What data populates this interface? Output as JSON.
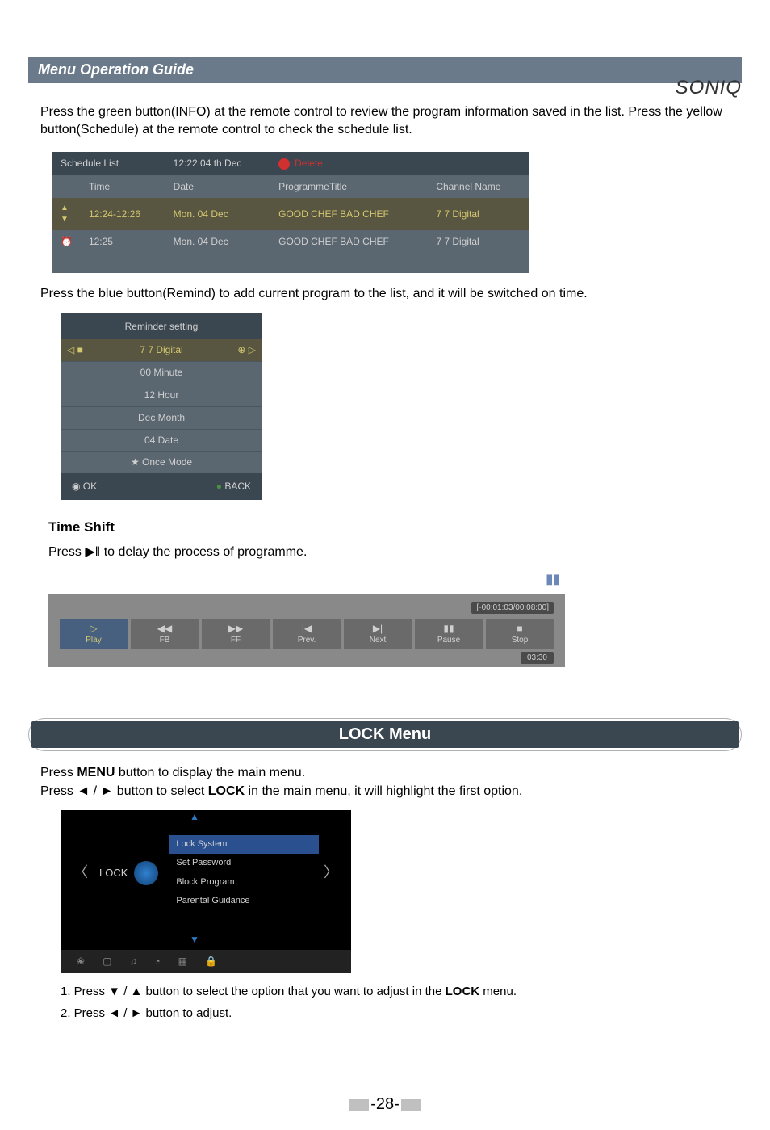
{
  "logo": "SONIQ",
  "header": "Menu Operation Guide",
  "intro1": "Press the green button(INFO) at the remote control to review the program information saved in the list. Press the yellow button(Schedule) at the remote control to check the schedule list.",
  "schedule": {
    "title": "Schedule List",
    "datetime": "12:22  04 th Dec",
    "delete": "Delete",
    "cols": {
      "time": "Time",
      "date": "Date",
      "prog": "ProgrammeTitle",
      "chan": "Channel Name"
    },
    "rows": [
      {
        "icon": "■◄",
        "time": "12:24-12:26",
        "date": "Mon. 04 Dec",
        "prog": "GOOD CHEF BAD CHEF",
        "chan": "7 7 Digital",
        "highlight": true
      },
      {
        "icon": "⏰",
        "time": "12:25",
        "date": "Mon. 04 Dec",
        "prog": "GOOD CHEF BAD CHEF",
        "chan": "7 7 Digital",
        "highlight": false
      }
    ]
  },
  "intro2": "Press the blue button(Remind) to add current program to the list, and it will be switched on time.",
  "reminder": {
    "title": "Reminder setting",
    "channel": "7 7 Digital",
    "rows": [
      "00 Minute",
      "12 Hour",
      "Dec Month",
      "04 Date",
      "★   Once Mode"
    ],
    "ok": "◉ OK",
    "back": "BACK"
  },
  "timeshift": {
    "title": "Time Shift",
    "desc": "Press ▶‖ to delay the process of programme.",
    "pauseicon": "▮▮",
    "elapsed": "[-00:01:03/00:08:00]",
    "controls": [
      {
        "icon": "▷",
        "label": "Play",
        "active": true
      },
      {
        "icon": "◀◀",
        "label": "FB"
      },
      {
        "icon": "▶▶",
        "label": "FF"
      },
      {
        "icon": "|◀",
        "label": "Prev."
      },
      {
        "icon": "▶|",
        "label": "Next"
      },
      {
        "icon": "▮▮",
        "label": "Pause"
      },
      {
        "icon": "■",
        "label": "Stop"
      }
    ],
    "bottomTime": "03:30"
  },
  "lockSection": "LOCK  Menu",
  "lockIntro1": "Press MENU button to display the main menu.",
  "lockIntro2": "Press ◄ / ► button to select LOCK in the main menu, it will highlight the first option.",
  "lockMenu": {
    "label": "LOCK",
    "options": [
      "Lock System",
      "Set Password",
      "Block Program",
      "Parental Guidance"
    ],
    "icons": [
      "❀",
      "▢",
      "♫",
      "◔",
      "▦",
      "🔒"
    ]
  },
  "inst1": "1. Press ▼ / ▲ button to select the option that you want to adjust in the LOCK menu.",
  "inst2": "2. Press ◄ / ► button to adjust.",
  "pageNum": "-28-"
}
